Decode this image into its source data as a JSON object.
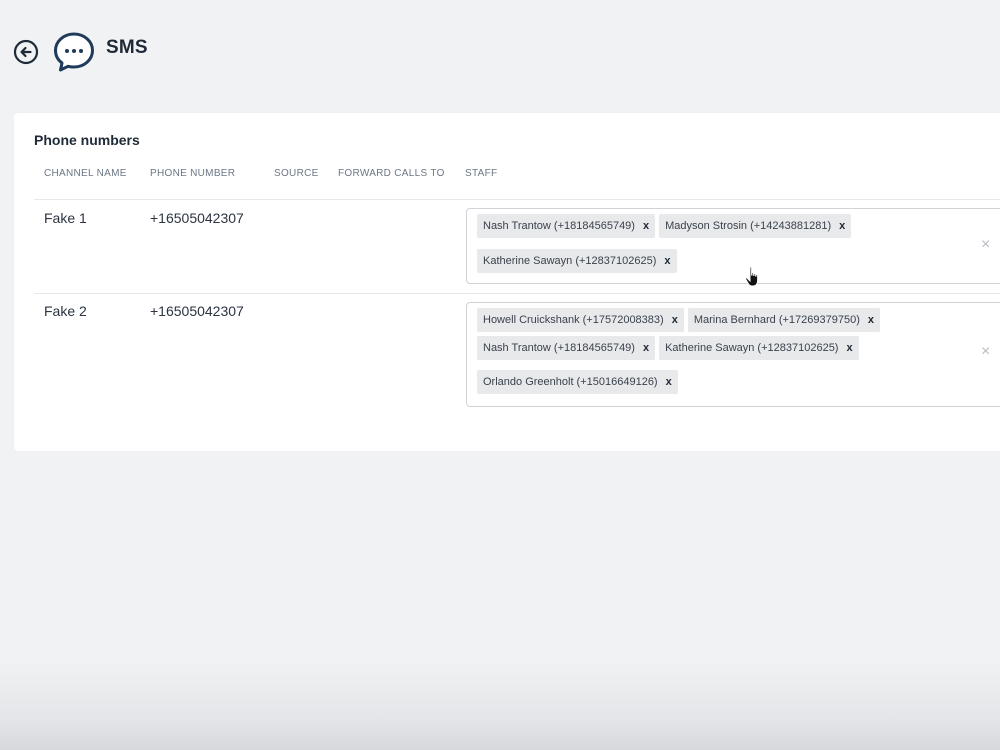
{
  "header": {
    "title": "SMS",
    "back_icon": "arrow-left-circle-icon",
    "app_icon": "chat-bubble-dots-icon"
  },
  "phone_numbers": {
    "title": "Phone numbers",
    "columns": [
      "CHANNEL NAME",
      "PHONE NUMBER",
      "SOURCE",
      "FORWARD CALLS TO",
      "STAFF"
    ],
    "rows": [
      {
        "channel_name": "Fake 1",
        "phone_number": "+16505042307",
        "source": "",
        "forward_calls_to": "",
        "staff": [
          "Nash Trantow (+18184565749)",
          "Madyson Strosin (+14243881281)",
          "Katherine Sawayn (+12837102625)"
        ]
      },
      {
        "channel_name": "Fake 2",
        "phone_number": "+16505042307",
        "source": "",
        "forward_calls_to": "",
        "staff": [
          "Howell Cruickshank (+17572008383)",
          "Marina Bernhard (+17269379750)",
          "Nash Trantow (+18184565749)",
          "Katherine Sawayn (+12837102625)",
          "Orlando Greenholt (+15016649126)"
        ]
      }
    ],
    "chip_remove_glyph": "x",
    "clear_glyph": "×"
  },
  "colors": {
    "background": "#f1f2f4",
    "card": "#ffffff",
    "chip": "#e8e9eb",
    "icon": "#1f3a5a"
  }
}
